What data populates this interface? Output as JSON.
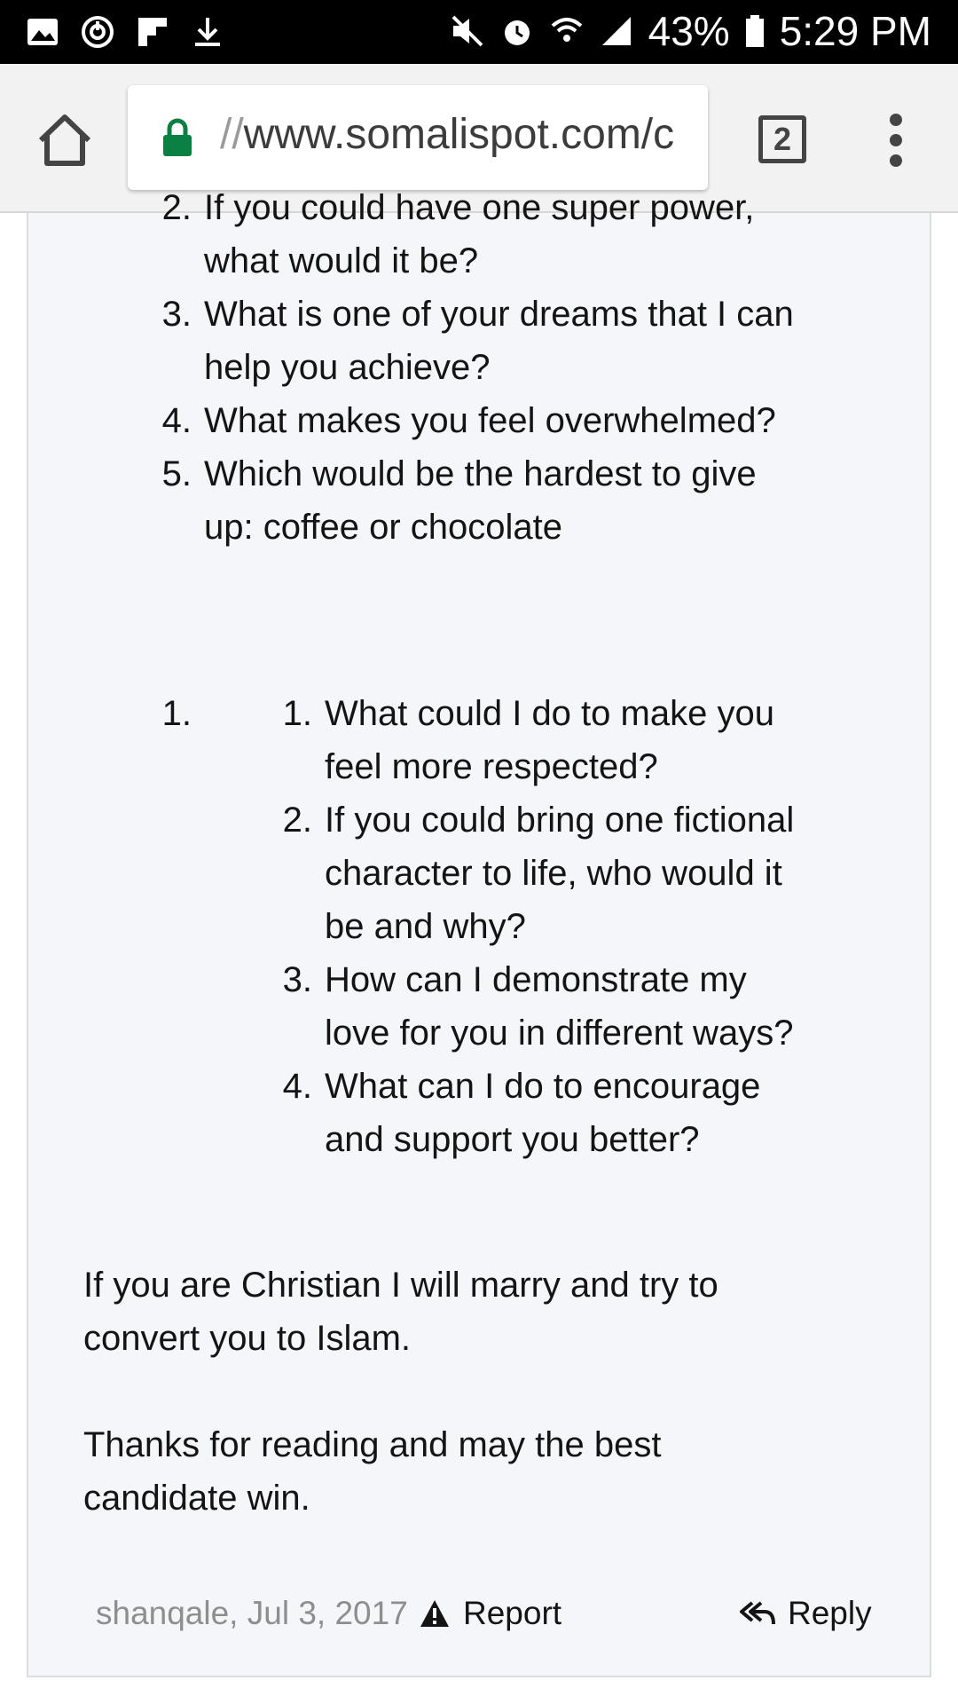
{
  "status_bar": {
    "battery": "43%",
    "time": "5:29 PM",
    "left_icons": [
      "image-icon",
      "sync-icon",
      "flipboard-icon",
      "download-icon"
    ],
    "right_icons": [
      "mute-icon",
      "alarm-icon",
      "wifi-icon",
      "signal-icon",
      "battery-icon"
    ]
  },
  "browser": {
    "url_prefix": "//",
    "url": "www.somalispot.com/c",
    "tab_count": "2"
  },
  "post": {
    "list_a": [
      {
        "num": "2.",
        "line1": "If you could have one super power,",
        "line2": "what would it be?"
      },
      {
        "num": "3.",
        "line1": "What is one of your dreams that I can",
        "line2": "help you achieve?"
      },
      {
        "num": "4.",
        "line1": "What makes you feel overwhelmed?",
        "line2": ""
      },
      {
        "num": "5.",
        "line1": "Which would be the hardest to give",
        "line2": "up: coffee or chocolate"
      }
    ],
    "outer_num": "1.",
    "list_b": [
      {
        "num": "1.",
        "lines": [
          "What could I do to make you",
          "feel more respected?"
        ]
      },
      {
        "num": "2.",
        "lines": [
          "If you could bring one fictional",
          "character to life, who would it",
          "be and why?"
        ]
      },
      {
        "num": "3.",
        "lines": [
          "How can I demonstrate my",
          "love for you in different ways?"
        ]
      },
      {
        "num": "4.",
        "lines": [
          "What can I do to encourage",
          "and support you better?"
        ]
      }
    ],
    "para1": [
      "If you are Christian I will marry and try to",
      "convert you to Islam."
    ],
    "para2": [
      "Thanks for reading and may the best",
      "candidate win."
    ],
    "author_date": "shanqale, Jul 3, 2017",
    "report_label": "Report",
    "reply_label": "Reply"
  }
}
